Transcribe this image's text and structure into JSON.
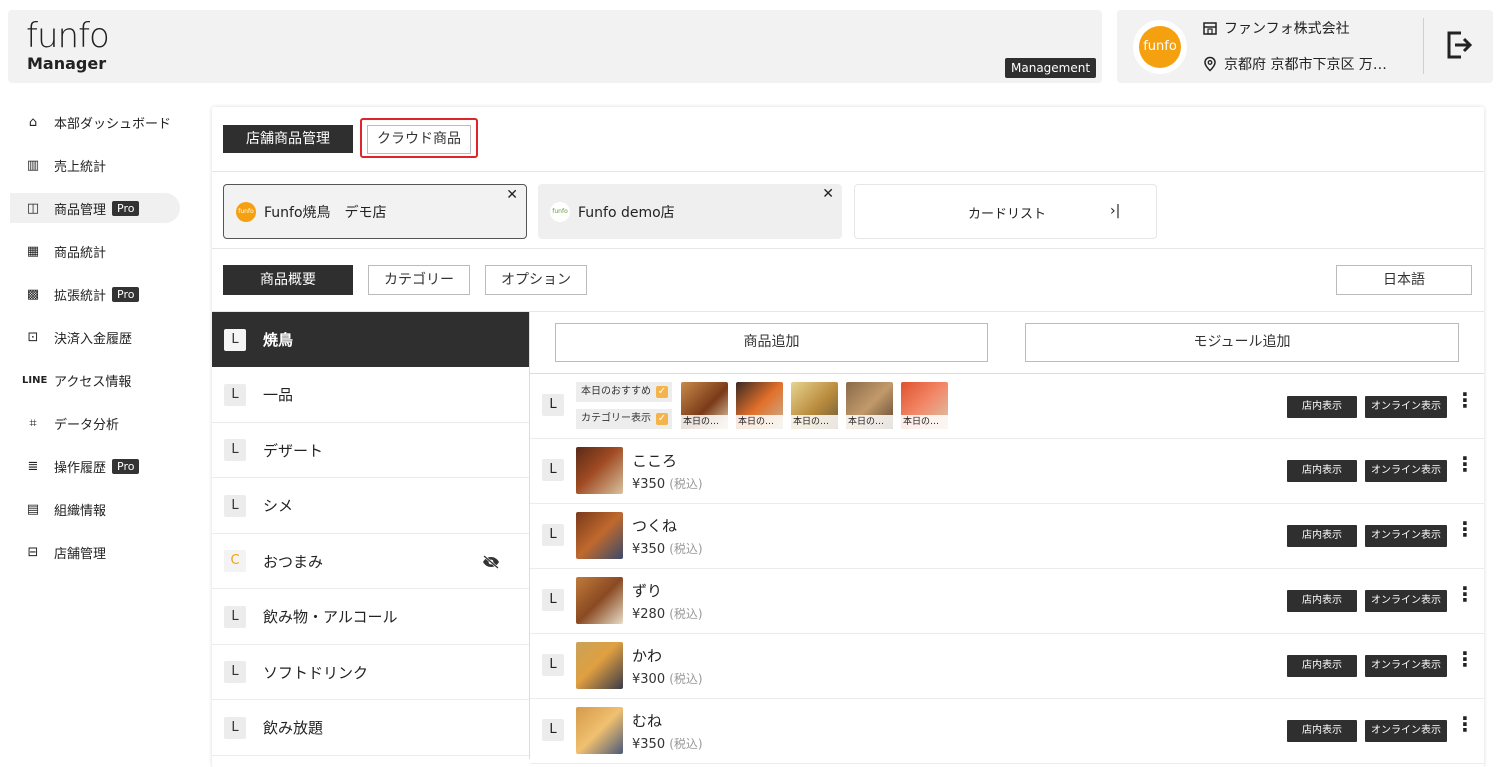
{
  "header": {
    "logo_top": "funfo",
    "logo_bottom": "Manager",
    "badge": "Management",
    "avatar_text": "funfo",
    "company": "ファンフォ株式会社",
    "address": "京都府 京都市下京区 万…"
  },
  "sidebar": {
    "items": [
      {
        "icon": "⌂",
        "label": "本部ダッシュボード"
      },
      {
        "icon": "▥",
        "label": "売上統計"
      },
      {
        "icon": "◫",
        "label": "商品管理",
        "pro": "Pro"
      },
      {
        "icon": "▦",
        "label": "商品統計"
      },
      {
        "icon": "▩",
        "label": "拡張統計",
        "pro": "Pro"
      },
      {
        "icon": "⊡",
        "label": "決済入金履歴"
      },
      {
        "icon": "LINE",
        "label": "アクセス情報"
      },
      {
        "icon": "⌗",
        "label": "データ分析"
      },
      {
        "icon": "≣",
        "label": "操作履歴",
        "pro": "Pro"
      },
      {
        "icon": "▤",
        "label": "組織情報"
      },
      {
        "icon": "⊟",
        "label": "店舗管理"
      }
    ]
  },
  "top_tabs": {
    "store_products": "店舗商品管理",
    "cloud_products": "クラウド商品"
  },
  "stores": [
    {
      "name": "Funfo焼鳥　デモ店"
    },
    {
      "name": "Funfo demo店"
    }
  ],
  "card_list": {
    "label": "カードリスト",
    "icon": "→|"
  },
  "sub_tabs": {
    "overview": "商品概要",
    "category": "カテゴリー",
    "option": "オプション",
    "language": "日本語"
  },
  "actions": {
    "add_product": "商品追加",
    "add_module": "モジュール追加"
  },
  "categories": [
    {
      "badge": "L",
      "name": "焼鳥"
    },
    {
      "badge": "L",
      "name": "一品"
    },
    {
      "badge": "L",
      "name": "デザート"
    },
    {
      "badge": "L",
      "name": "シメ"
    },
    {
      "badge": "C",
      "name": "おつまみ",
      "hidden": true
    },
    {
      "badge": "L",
      "name": "飲み物・アルコール"
    },
    {
      "badge": "L",
      "name": "ソフトドリンク"
    },
    {
      "badge": "L",
      "name": "飲み放題"
    }
  ],
  "module_row": {
    "badge": "L",
    "check1": "本日のおすすめ",
    "check2": "カテゴリー表示",
    "captions": [
      "本日の…",
      "本日の…",
      "本日の…",
      "本日の…",
      "本日の…"
    ]
  },
  "tags": {
    "in_store": "店内表示",
    "online": "オンライン表示"
  },
  "products": [
    {
      "badge": "L",
      "name": "こころ",
      "price": "¥350",
      "tax": "(税込)"
    },
    {
      "badge": "L",
      "name": "つくね",
      "price": "¥350",
      "tax": "(税込)"
    },
    {
      "badge": "L",
      "name": "ずり",
      "price": "¥280",
      "tax": "(税込)"
    },
    {
      "badge": "L",
      "name": "かわ",
      "price": "¥300",
      "tax": "(税込)"
    },
    {
      "badge": "L",
      "name": "むね",
      "price": "¥350",
      "tax": "(税込)"
    }
  ],
  "colors": {
    "accent": "#f5a00f",
    "dark": "#2f2f2f",
    "highlight": "#e0242b"
  }
}
